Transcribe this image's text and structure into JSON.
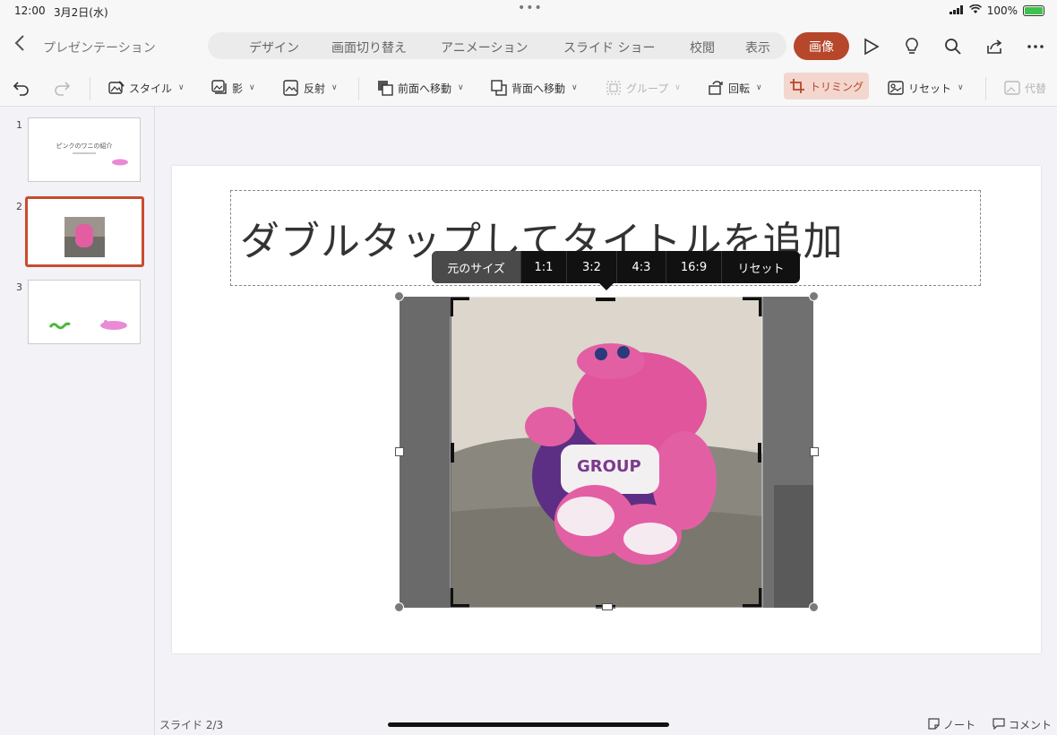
{
  "status_bar": {
    "time": "12:00",
    "date": "3月2日(水)",
    "dots": "•••",
    "battery": "100%"
  },
  "nav": {
    "document_title": "プレゼンテーション"
  },
  "tabs": [
    {
      "label": "デザイン"
    },
    {
      "label": "画面切り替え"
    },
    {
      "label": "アニメーション"
    },
    {
      "label": "スライド ショー"
    },
    {
      "label": "校閲"
    },
    {
      "label": "表示"
    }
  ],
  "active_tab": "画像",
  "ribbon": {
    "style": "スタイル",
    "shadow": "影",
    "reflection": "反射",
    "bring_forward": "前面へ移動",
    "send_backward": "背面へ移動",
    "group": "グループ",
    "rotate": "回転",
    "trim": "トリミング",
    "reset": "リセット",
    "alt": "代替"
  },
  "thumbnails": [
    {
      "number": "1",
      "title": "ピンクのワニの紹介"
    },
    {
      "number": "2"
    },
    {
      "number": "3"
    }
  ],
  "slide": {
    "title_placeholder": "ダブルタップしてタイトルを追加"
  },
  "crop_toolbar": [
    "元のサイズ",
    "1:1",
    "3:2",
    "4:3",
    "16:9",
    "リセット"
  ],
  "footer": {
    "slide_count": "スライド 2/3",
    "notes": "ノート",
    "comments": "コメント"
  },
  "colors": {
    "accent": "#b7472a",
    "selection_border": "#c94b2f"
  }
}
